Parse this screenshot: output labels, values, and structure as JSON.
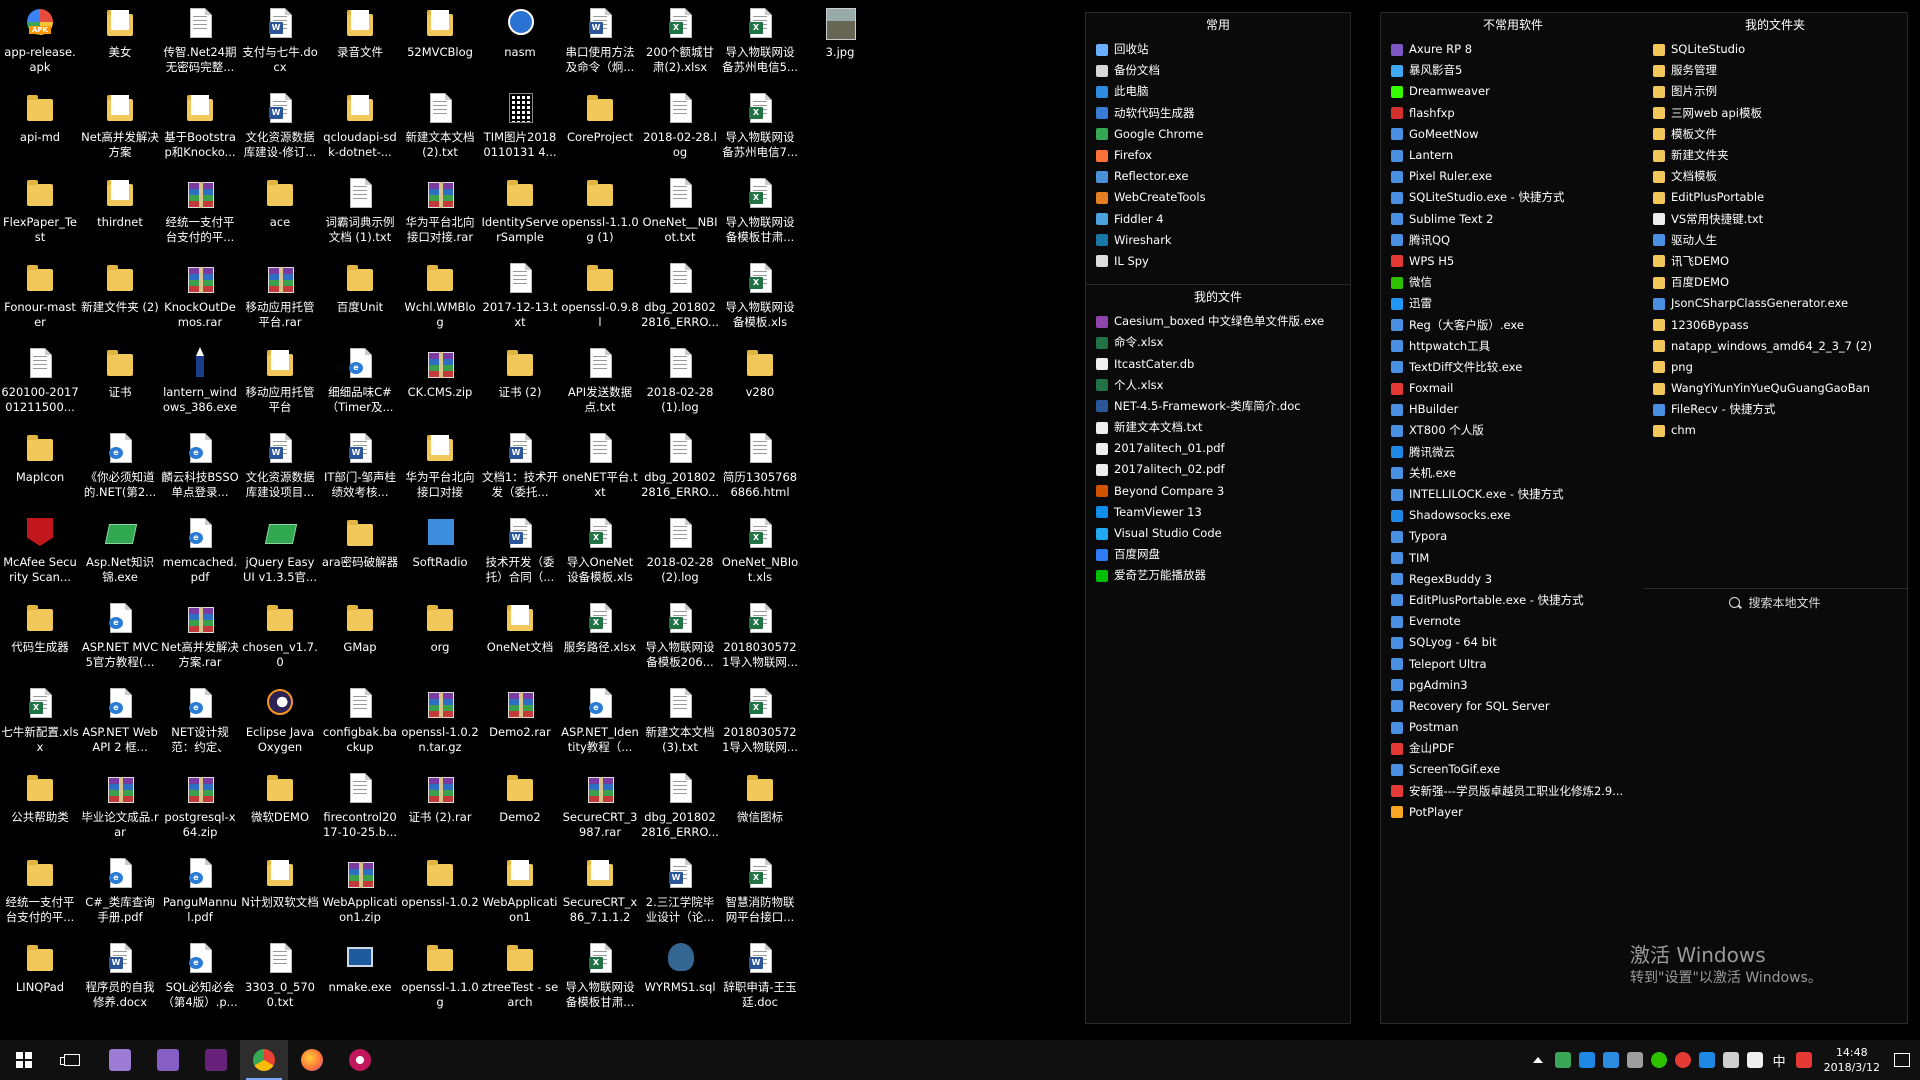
{
  "desktop_icons": [
    {
      "label": "app-release.apk",
      "icon": "apk-icon",
      "kind": "apk"
    },
    {
      "label": "api-md",
      "icon": "folder-icon",
      "kind": "folder"
    },
    {
      "label": "FlexPaper_Test",
      "icon": "folder-icon",
      "kind": "folder"
    },
    {
      "label": "Fonour-master",
      "icon": "folder-icon",
      "kind": "folder"
    },
    {
      "label": "620100-201701211500...",
      "icon": "document-icon",
      "kind": "doc"
    },
    {
      "label": "MapIcon",
      "icon": "folder-icon",
      "kind": "folder"
    },
    {
      "label": "McAfee Security Scan...",
      "icon": "mcafee-icon",
      "kind": "mcafee"
    },
    {
      "label": "代码生成器",
      "icon": "folder-icon",
      "kind": "folder"
    },
    {
      "label": "七牛新配置.xlsx",
      "icon": "excel-icon",
      "kind": "excel"
    },
    {
      "label": "公共帮助类",
      "icon": "folder-icon",
      "kind": "folder"
    },
    {
      "label": "经统一支付平台支付的平...",
      "icon": "folder-icon",
      "kind": "folder"
    },
    {
      "label": "LINQPad",
      "icon": "folder-icon",
      "kind": "folder"
    },
    {
      "label": "美女",
      "icon": "folder-icon",
      "kind": "folderdoc"
    },
    {
      "label": "Net高并发解决方案",
      "icon": "folder-icon",
      "kind": "folderdoc"
    },
    {
      "label": "thirdnet",
      "icon": "folder-icon",
      "kind": "folderdoc"
    },
    {
      "label": "新建文件夹 (2)",
      "icon": "folder-icon",
      "kind": "folder"
    },
    {
      "label": "证书",
      "icon": "folder-icon",
      "kind": "folder"
    },
    {
      "label": "《你必须知道的.NET(第2...",
      "icon": "pdf-icon",
      "kind": "pdf"
    },
    {
      "label": "Asp.Net知识锦.exe",
      "icon": "book-icon",
      "kind": "book"
    },
    {
      "label": "ASP.NET MVC5官方教程(...",
      "icon": "pdf-icon",
      "kind": "pdf"
    },
    {
      "label": "ASP.NET Web API 2 框...",
      "icon": "pdf-icon",
      "kind": "pdf"
    },
    {
      "label": "毕业论文成品.rar",
      "icon": "rar-icon",
      "kind": "rar"
    },
    {
      "label": "C#_类库查询手册.pdf",
      "icon": "pdf-icon",
      "kind": "pdf"
    },
    {
      "label": "程序员的自我修养.docx",
      "icon": "word-icon",
      "kind": "word"
    },
    {
      "label": "传智.Net24期无密码完整...",
      "icon": "document-icon",
      "kind": "doc"
    },
    {
      "label": "基于Bootstrap和Knocko...",
      "icon": "folder-icon",
      "kind": "folderdoc"
    },
    {
      "label": "经统一支付平台支付的平...",
      "icon": "rar-icon",
      "kind": "rar"
    },
    {
      "label": "KnockOutDemos.rar",
      "icon": "rar-icon",
      "kind": "rar"
    },
    {
      "label": "lantern_windows_386.exe",
      "icon": "lantern-icon",
      "kind": "pen"
    },
    {
      "label": "麟云科技BSSO单点登录...",
      "icon": "pdf-icon",
      "kind": "pdf"
    },
    {
      "label": "memcached.pdf",
      "icon": "pdf-icon",
      "kind": "pdf"
    },
    {
      "label": "Net高并发解决方案.rar",
      "icon": "rar-icon",
      "kind": "rar"
    },
    {
      "label": "NET设计规范：约定、惯...",
      "icon": "pdf-icon",
      "kind": "pdf"
    },
    {
      "label": "postgresql-x64.zip",
      "icon": "rar-icon",
      "kind": "rar"
    },
    {
      "label": "PanguMannul.pdf",
      "icon": "pdf-icon",
      "kind": "pdf"
    },
    {
      "label": "SQL必知必会（第4版）.p...",
      "icon": "pdf-icon",
      "kind": "pdf"
    },
    {
      "label": "支付与七牛.docx",
      "icon": "word-icon",
      "kind": "word"
    },
    {
      "label": "文化资源数据库建设-修订...",
      "icon": "word-icon",
      "kind": "word"
    },
    {
      "label": "ace",
      "icon": "folder-icon",
      "kind": "folder"
    },
    {
      "label": "移动应用托管平台.rar",
      "icon": "rar-icon",
      "kind": "rar"
    },
    {
      "label": "移动应用托管平台",
      "icon": "folder-icon",
      "kind": "folderdoc"
    },
    {
      "label": "文化资源数据库建设项目...",
      "icon": "word-icon",
      "kind": "word"
    },
    {
      "label": "jQuery Easy UI v1.3.5官...",
      "icon": "book-icon",
      "kind": "book"
    },
    {
      "label": "chosen_v1.7.0",
      "icon": "folder-icon",
      "kind": "folder"
    },
    {
      "label": "Eclipse Java Oxygen",
      "icon": "eclipse-icon",
      "kind": "eclipse"
    },
    {
      "label": "微软DEMO",
      "icon": "folder-icon",
      "kind": "folder"
    },
    {
      "label": "N计划双软文档",
      "icon": "folder-icon",
      "kind": "folderdoc"
    },
    {
      "label": "3303_0_5700.txt",
      "icon": "text-file-icon",
      "kind": "doc"
    },
    {
      "label": "录音文件",
      "icon": "folder-icon",
      "kind": "folderdoc"
    },
    {
      "label": "qcloudapi-sdk-dotnet-...",
      "icon": "folder-icon",
      "kind": "folderdoc"
    },
    {
      "label": "词霸词典示例文档 (1).txt",
      "icon": "text-file-icon",
      "kind": "doc"
    },
    {
      "label": "百度Unit",
      "icon": "folder-icon",
      "kind": "folder"
    },
    {
      "label": "细细品味C#（Timer及...",
      "icon": "pdf-icon",
      "kind": "pdf"
    },
    {
      "label": "IT部门-邹声桂绩效考核...",
      "icon": "word-icon",
      "kind": "word"
    },
    {
      "label": "ara密码破解器",
      "icon": "folder-icon",
      "kind": "folder"
    },
    {
      "label": "GMap",
      "icon": "folder-icon",
      "kind": "folder"
    },
    {
      "label": "configbak.backup",
      "icon": "document-icon",
      "kind": "doc"
    },
    {
      "label": "firecontrol2017-10-25.b...",
      "icon": "document-icon",
      "kind": "doc"
    },
    {
      "label": "WebApplication1.zip",
      "icon": "rar-icon",
      "kind": "rar"
    },
    {
      "label": "nmake.exe",
      "icon": "nmake-icon",
      "kind": "nmake"
    },
    {
      "label": "52MVCBlog",
      "icon": "folder-icon",
      "kind": "folderdoc"
    },
    {
      "label": "新建文本文档 (2).txt",
      "icon": "text-file-icon",
      "kind": "doc"
    },
    {
      "label": "华为平台北向接口对接.rar",
      "icon": "rar-icon",
      "kind": "rar"
    },
    {
      "label": "Wchl.WMBlog",
      "icon": "folder-icon",
      "kind": "folder"
    },
    {
      "label": "CK.CMS.zip",
      "icon": "rar-icon",
      "kind": "rar"
    },
    {
      "label": "华为平台北向接口对接",
      "icon": "folder-icon",
      "kind": "folderdoc"
    },
    {
      "label": "SoftRadio",
      "icon": "softradio-icon",
      "kind": "soft"
    },
    {
      "label": "org",
      "icon": "folder-icon",
      "kind": "folder"
    },
    {
      "label": "openssl-1.0.2n.tar.gz",
      "icon": "rar-icon",
      "kind": "rar"
    },
    {
      "label": "证书 (2).rar",
      "icon": "rar-icon",
      "kind": "rar"
    },
    {
      "label": "openssl-1.0.2",
      "icon": "folder-icon",
      "kind": "folder"
    },
    {
      "label": "openssl-1.1.0g",
      "icon": "folder-icon",
      "kind": "folder"
    },
    {
      "label": "nasm",
      "icon": "nasm-icon",
      "kind": "round"
    },
    {
      "label": "TIM图片20180110131 4...",
      "icon": "qr-icon",
      "kind": "qr"
    },
    {
      "label": "IdentityServerSample",
      "icon": "folder-icon",
      "kind": "folder"
    },
    {
      "label": "2017-12-13.txt",
      "icon": "text-file-icon",
      "kind": "doc"
    },
    {
      "label": "证书 (2)",
      "icon": "folder-icon",
      "kind": "folder"
    },
    {
      "label": "文档1：技术开发（委托...",
      "icon": "word-icon",
      "kind": "word"
    },
    {
      "label": "技术开发（委托）合同（...",
      "icon": "word-icon",
      "kind": "word"
    },
    {
      "label": "OneNet文档",
      "icon": "folder-icon",
      "kind": "folderdoc"
    },
    {
      "label": "Demo2.rar",
      "icon": "rar-icon",
      "kind": "rar"
    },
    {
      "label": "Demo2",
      "icon": "folder-icon",
      "kind": "folder"
    },
    {
      "label": "WebApplication1",
      "icon": "folder-icon",
      "kind": "folderdoc"
    },
    {
      "label": "ztreeTest - search",
      "icon": "folder-icon",
      "kind": "folder"
    },
    {
      "label": "串口使用方法及命令（炯...",
      "icon": "word-icon",
      "kind": "word"
    },
    {
      "label": "CoreProject",
      "icon": "folder-icon",
      "kind": "folder"
    },
    {
      "label": "openssl-1.1.0g (1)",
      "icon": "folder-icon",
      "kind": "folder"
    },
    {
      "label": "openssl-0.9.8l",
      "icon": "folder-icon",
      "kind": "folder"
    },
    {
      "label": "API发送数据点.txt",
      "icon": "text-file-icon",
      "kind": "doc"
    },
    {
      "label": "oneNET平台.txt",
      "icon": "text-file-icon",
      "kind": "doc"
    },
    {
      "label": "导入OneNet设备模板.xls",
      "icon": "excel-icon",
      "kind": "excel"
    },
    {
      "label": "服务路径.xlsx",
      "icon": "excel-icon",
      "kind": "excel"
    },
    {
      "label": "ASP.NET_Identity教程（...",
      "icon": "pdf-icon",
      "kind": "pdf"
    },
    {
      "label": "SecureCRT_3987.rar",
      "icon": "rar-icon",
      "kind": "rar"
    },
    {
      "label": "SecureCRT_x86_7.1.1.26...",
      "icon": "folder-icon",
      "kind": "folderdoc"
    },
    {
      "label": "导入物联网设备模板甘肃...",
      "icon": "excel-icon",
      "kind": "excel"
    },
    {
      "label": "200个额城甘肃(2).xlsx",
      "icon": "excel-icon",
      "kind": "excel"
    },
    {
      "label": "2018-02-28.log",
      "icon": "text-file-icon",
      "kind": "doc"
    },
    {
      "label": "OneNet__NBIot.txt",
      "icon": "text-file-icon",
      "kind": "doc"
    },
    {
      "label": "dbg_2018022816_ERRO...",
      "icon": "text-file-icon",
      "kind": "doc"
    },
    {
      "label": "2018-02-28 (1).log",
      "icon": "text-file-icon",
      "kind": "doc"
    },
    {
      "label": "dbg_2018022816_ERRO...",
      "icon": "text-file-icon",
      "kind": "doc"
    },
    {
      "label": "2018-02-28 (2).log",
      "icon": "text-file-icon",
      "kind": "doc"
    },
    {
      "label": "导入物联网设备模板206...",
      "icon": "excel-icon",
      "kind": "excel"
    },
    {
      "label": "新建文本文档 (3).txt",
      "icon": "text-file-icon",
      "kind": "doc"
    },
    {
      "label": "dbg_2018022816_ERRO...",
      "icon": "text-file-icon",
      "kind": "doc"
    },
    {
      "label": "2.三江学院毕业设计（论...",
      "icon": "word-icon",
      "kind": "word"
    },
    {
      "label": "WYRMS1.sql",
      "icon": "postgresql-icon",
      "kind": "elephant"
    },
    {
      "label": "导入物联网设备苏州电信5...",
      "icon": "excel-icon",
      "kind": "excel"
    },
    {
      "label": "导入物联网设备苏州电信7...",
      "icon": "excel-icon",
      "kind": "excel"
    },
    {
      "label": "导入物联网设备模板甘肃...",
      "icon": "excel-icon",
      "kind": "excel"
    },
    {
      "label": "导入物联网设备模板.xls",
      "icon": "excel-icon",
      "kind": "excel"
    },
    {
      "label": "v280",
      "icon": "folder-icon",
      "kind": "folder"
    },
    {
      "label": "简历13057686866.html",
      "icon": "html-file-icon",
      "kind": "doc"
    },
    {
      "label": "OneNet_NBIot.xls",
      "icon": "excel-icon",
      "kind": "excel"
    },
    {
      "label": "20180305721导入物联网...",
      "icon": "excel-icon",
      "kind": "excel"
    },
    {
      "label": "20180305721导入物联网...",
      "icon": "excel-icon",
      "kind": "excel"
    },
    {
      "label": "微信图标",
      "icon": "folder-icon",
      "kind": "folder"
    },
    {
      "label": "智慧消防物联网平台接口...",
      "icon": "excel-icon",
      "kind": "excel"
    },
    {
      "label": "辞职申请-王玉廷.doc",
      "icon": "word-icon",
      "kind": "word"
    },
    {
      "label": "3.jpg",
      "icon": "image-file-icon",
      "kind": "photo"
    }
  ],
  "start_menu": {
    "common": {
      "title": "常用",
      "items": [
        {
          "label": "回收站",
          "color": "#6ab0ff"
        },
        {
          "label": "备份文档",
          "color": "#d8d8d8"
        },
        {
          "label": "此电脑",
          "color": "#2b8ce0"
        },
        {
          "label": "动软代码生成器",
          "color": "#3a7bd5"
        },
        {
          "label": "Google Chrome",
          "color": "#34a853"
        },
        {
          "label": "Firefox",
          "color": "#ff7139"
        },
        {
          "label": "Reflector.exe",
          "color": "#4a90d9"
        },
        {
          "label": "WebCreateTools",
          "color": "#e67e22"
        },
        {
          "label": "Fiddler 4",
          "color": "#4aa3df"
        },
        {
          "label": "Wireshark",
          "color": "#1679a7"
        },
        {
          "label": "IL Spy",
          "color": "#dddddd"
        }
      ]
    },
    "myfiles": {
      "title": "我的文件",
      "items": [
        {
          "label": "Caesium_boxed 中文绿色单文件版.exe",
          "color": "#8e44ad"
        },
        {
          "label": "命令.xlsx",
          "color": "#217346"
        },
        {
          "label": "ItcastCater.db",
          "color": "#eeeeee"
        },
        {
          "label": "个人.xlsx",
          "color": "#217346"
        },
        {
          "label": "NET-4.5-Framework-类库简介.doc",
          "color": "#2b579a"
        },
        {
          "label": "新建文本文档.txt",
          "color": "#eeeeee"
        },
        {
          "label": "2017alitech_01.pdf",
          "color": "#eeeeee"
        },
        {
          "label": "2017alitech_02.pdf",
          "color": "#eeeeee"
        },
        {
          "label": "Beyond Compare 3",
          "color": "#d35400"
        },
        {
          "label": "TeamViewer 13",
          "color": "#0e8ee9"
        },
        {
          "label": "Visual Studio Code",
          "color": "#23a9f2"
        },
        {
          "label": "百度网盘",
          "color": "#2d7cf6"
        },
        {
          "label": "爱奇艺万能播放器",
          "color": "#00be06"
        }
      ]
    },
    "software": {
      "title": "不常用软件",
      "items": [
        {
          "label": "Axure RP 8",
          "color": "#7e57c2"
        },
        {
          "label": "暴风影音5",
          "color": "#3fa9f5"
        },
        {
          "label": "Dreamweaver",
          "color": "#35fa00"
        },
        {
          "label": "flashfxp",
          "color": "#d32f2f"
        },
        {
          "label": "GoMeetNow",
          "color": "#4a90e2"
        },
        {
          "label": "Lantern",
          "color": "#4a90e2"
        },
        {
          "label": "Pixel Ruler.exe",
          "color": "#4a90e2"
        },
        {
          "label": "SQLiteStudio.exe - 快捷方式",
          "color": "#4a90e2"
        },
        {
          "label": "Sublime Text 2",
          "color": "#4a90e2"
        },
        {
          "label": "腾讯QQ",
          "color": "#4a90e2"
        },
        {
          "label": "WPS H5",
          "color": "#e53935"
        },
        {
          "label": "微信",
          "color": "#2dc100"
        },
        {
          "label": "迅雷",
          "color": "#2196f3"
        },
        {
          "label": "Reg（大客户版）.exe",
          "color": "#4a90e2"
        },
        {
          "label": "httpwatch工具",
          "color": "#4a90e2"
        },
        {
          "label": "TextDiff文件比较.exe",
          "color": "#4a90e2"
        },
        {
          "label": "Foxmail",
          "color": "#e53935"
        },
        {
          "label": "HBuilder",
          "color": "#4a90e2"
        },
        {
          "label": "XT800 个人版",
          "color": "#4a90e2"
        },
        {
          "label": "腾讯微云",
          "color": "#1e88e5"
        },
        {
          "label": "关机.exe",
          "color": "#4a90e2"
        },
        {
          "label": "INTELLILOCK.exe - 快捷方式",
          "color": "#4a90e2"
        },
        {
          "label": "Shadowsocks.exe",
          "color": "#1e88e5"
        },
        {
          "label": "Typora",
          "color": "#4a90e2"
        },
        {
          "label": "TIM",
          "color": "#4a90e2"
        },
        {
          "label": "RegexBuddy 3",
          "color": "#4a90e2"
        },
        {
          "label": "EditPlusPortable.exe - 快捷方式",
          "color": "#4a90e2"
        },
        {
          "label": "Evernote",
          "color": "#4a90e2"
        },
        {
          "label": "SQLyog - 64 bit",
          "color": "#4a90e2"
        },
        {
          "label": "Teleport Ultra",
          "color": "#4a90e2"
        },
        {
          "label": "pgAdmin3",
          "color": "#4a90e2"
        },
        {
          "label": "Recovery for SQL Server",
          "color": "#4a90e2"
        },
        {
          "label": "Postman",
          "color": "#4a90e2"
        },
        {
          "label": "金山PDF",
          "color": "#e53935"
        },
        {
          "label": "ScreenToGif.exe",
          "color": "#4a90e2"
        },
        {
          "label": "安新强---学员版卓越员工职业化修炼2.9...",
          "color": "#e53935"
        },
        {
          "label": "PotPlayer",
          "color": "#f9a825"
        }
      ]
    },
    "myfolder": {
      "title": "我的文件夹",
      "items": [
        {
          "label": "SQLiteStudio",
          "color": "#f3c85a"
        },
        {
          "label": "服务管理",
          "color": "#f3c85a"
        },
        {
          "label": "图片示例",
          "color": "#f3c85a"
        },
        {
          "label": "三网web api模板",
          "color": "#f3c85a"
        },
        {
          "label": "模板文件",
          "color": "#f3c85a"
        },
        {
          "label": "新建文件夹",
          "color": "#f3c85a"
        },
        {
          "label": "文档模板",
          "color": "#f3c85a"
        },
        {
          "label": "EditPlusPortable",
          "color": "#f3c85a"
        },
        {
          "label": "VS常用快捷键.txt",
          "color": "#eeeeee"
        },
        {
          "label": "驱动人生",
          "color": "#4a90e2"
        },
        {
          "label": "讯飞DEMO",
          "color": "#f3c85a"
        },
        {
          "label": "百度DEMO",
          "color": "#f3c85a"
        },
        {
          "label": "JsonCSharpClassGenerator.exe",
          "color": "#4a90e2"
        },
        {
          "label": "12306Bypass",
          "color": "#f3c85a"
        },
        {
          "label": "natapp_windows_amd64_2_3_7 (2)",
          "color": "#f3c85a"
        },
        {
          "label": "png",
          "color": "#f3c85a"
        },
        {
          "label": "WangYiYunYinYueQuGuangGaoBan",
          "color": "#f3c85a"
        },
        {
          "label": "FileRecv - 快捷方式",
          "color": "#4a90e2"
        },
        {
          "label": "chm",
          "color": "#f3c85a"
        }
      ],
      "search_label": "搜索本地文件"
    }
  },
  "watermark": {
    "line1": "激活 Windows",
    "line2": "转到\"设置\"以激活 Windows。"
  },
  "taskbar": {
    "apps": [
      {
        "name": "start-button",
        "icon": "windows-logo-icon"
      },
      {
        "name": "task-view-button",
        "icon": "task-view-icon"
      },
      {
        "name": "taskbar-app-tools",
        "icon": "tools-icon",
        "color": "#9c7bd4"
      },
      {
        "name": "taskbar-app-visual-studio",
        "icon": "visual-studio-icon",
        "color": "#865fc5"
      },
      {
        "name": "taskbar-app-visual-studio-2",
        "icon": "visual-studio-icon",
        "color": "#68217a"
      },
      {
        "name": "taskbar-app-chrome",
        "icon": "chrome-icon",
        "color": "#34a853",
        "active": true
      },
      {
        "name": "taskbar-app-firefox",
        "icon": "firefox-icon",
        "color": "#ff7139"
      },
      {
        "name": "taskbar-app-paint",
        "icon": "paint-icon",
        "color": "#c2185b"
      }
    ],
    "tray": {
      "ime": "中",
      "time": "14:48",
      "date": "2018/3/12"
    }
  }
}
